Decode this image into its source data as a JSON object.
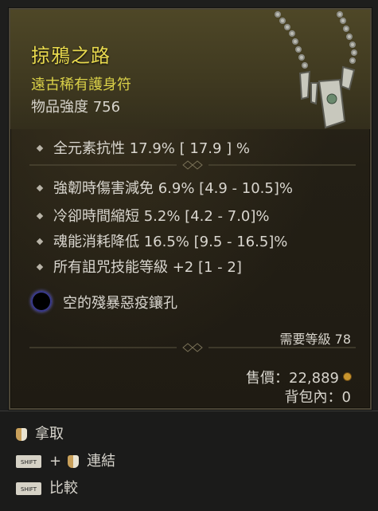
{
  "item": {
    "name": "掠鴉之路",
    "rarity_type": "遠古稀有護身符",
    "power_label": "物品強度 756"
  },
  "stats": {
    "primary": {
      "text": "全元素抗性 17.9%   [ 17.9 ] %"
    },
    "affixes": [
      {
        "text": "強韌時傷害減免 6.9% [4.9 - 10.5]%"
      },
      {
        "text": "冷卻時間縮短 5.2% [4.2 - 7.0]%"
      },
      {
        "text": "魂能消耗降低 16.5% [9.5 - 16.5]%"
      },
      {
        "text": "所有詛咒技能等級 +2 [1 - 2]"
      }
    ],
    "socket": {
      "text": "空的殘暴惡疫鑲孔"
    }
  },
  "requirements": {
    "level": "需要等級 78"
  },
  "value": {
    "price": "售價：22,889",
    "stash": "背包內：0"
  },
  "controls": {
    "take": "拿取",
    "link": "連結",
    "compare": "比較",
    "shift_key": "SHIFT",
    "plus": "+"
  },
  "colors": {
    "title": "#e8d94e",
    "rarity": "#d9d048",
    "text": "#d9d6cf",
    "coin": "#c8952e"
  },
  "icons": {
    "amulet": "amulet-icon",
    "socket": "socket-icon",
    "gold": "gold-coin-icon",
    "mouse": "mouse-icon",
    "shift": "shift-key-icon"
  }
}
